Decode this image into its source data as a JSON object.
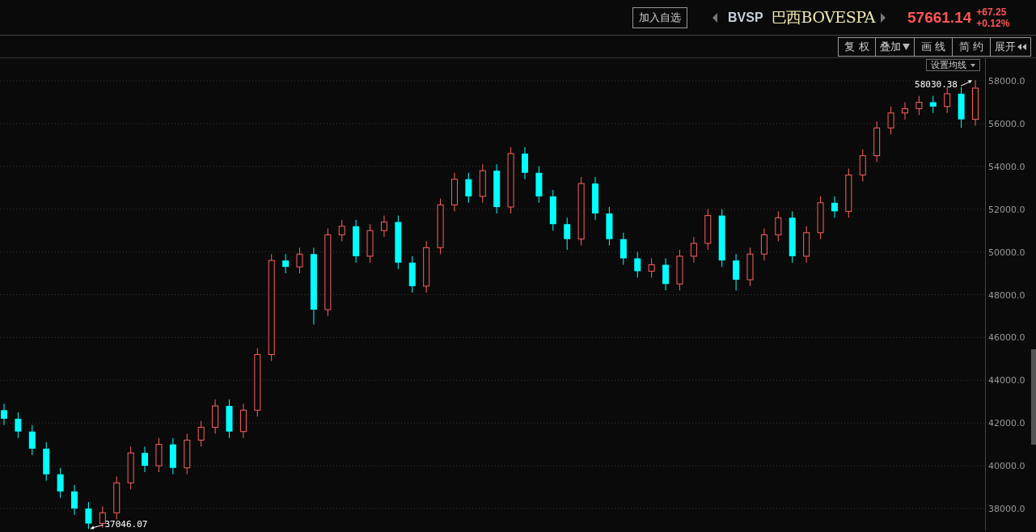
{
  "header": {
    "watch_button": "加入自选",
    "symbol": "BVSP",
    "name": "巴西BOVESPA",
    "price": "57661.14",
    "change": "+67.25",
    "change_percent": "+0.12%"
  },
  "toolbar": [
    {
      "label": "复 权",
      "kind": "plain"
    },
    {
      "label": "叠加",
      "kind": "dropdown"
    },
    {
      "label": "画 线",
      "kind": "plain"
    },
    {
      "label": "简 约",
      "kind": "plain"
    },
    {
      "label": "展开",
      "kind": "expand"
    }
  ],
  "ma_dropdown": "设置均线",
  "chart_data": {
    "type": "candlestick",
    "ylim": [
      36940,
      59060
    ],
    "yticks": [
      {
        "value": 38000,
        "label": "38000.0"
      },
      {
        "value": 40000,
        "label": "40000.0"
      },
      {
        "value": 42000,
        "label": "42000.0"
      },
      {
        "value": 44000,
        "label": "44000.0"
      },
      {
        "value": 46000,
        "label": "46000.0"
      },
      {
        "value": 48000,
        "label": "48000.0"
      },
      {
        "value": 50000,
        "label": "50000.0"
      },
      {
        "value": 52000,
        "label": "52000.0"
      },
      {
        "value": 54000,
        "label": "54000.0"
      },
      {
        "value": 56000,
        "label": "56000.0"
      },
      {
        "value": 58000,
        "label": "58000.0"
      }
    ],
    "grid": true,
    "ohlc": [
      [
        42600,
        42900,
        41900,
        42200
      ],
      [
        42200,
        42500,
        41300,
        41600
      ],
      [
        41600,
        41900,
        40500,
        40800
      ],
      [
        40800,
        41100,
        39300,
        39600
      ],
      [
        39600,
        39900,
        38500,
        38800
      ],
      [
        38800,
        39100,
        37700,
        38000
      ],
      [
        38000,
        38300,
        37046,
        37300
      ],
      [
        37300,
        38100,
        37100,
        37800
      ],
      [
        37800,
        39500,
        37500,
        39200
      ],
      [
        39200,
        40900,
        38900,
        40600
      ],
      [
        40600,
        40900,
        39700,
        40000
      ],
      [
        40000,
        41300,
        39700,
        41000
      ],
      [
        41000,
        41300,
        39600,
        39900
      ],
      [
        39900,
        41500,
        39600,
        41200
      ],
      [
        41200,
        42100,
        40900,
        41800
      ],
      [
        41800,
        43100,
        41500,
        42800
      ],
      [
        42800,
        43100,
        41300,
        41600
      ],
      [
        41600,
        42900,
        41300,
        42600
      ],
      [
        42600,
        45500,
        42300,
        45200
      ],
      [
        45200,
        49900,
        44900,
        49600
      ],
      [
        49600,
        49900,
        49000,
        49300
      ],
      [
        49300,
        50200,
        49000,
        49900
      ],
      [
        49900,
        50200,
        46600,
        47300
      ],
      [
        47300,
        51100,
        47000,
        50800
      ],
      [
        50800,
        51500,
        50500,
        51200
      ],
      [
        51200,
        51500,
        49500,
        49800
      ],
      [
        49800,
        51300,
        49500,
        51000
      ],
      [
        51000,
        51700,
        50700,
        51400
      ],
      [
        51400,
        51700,
        49200,
        49500
      ],
      [
        49500,
        49800,
        48100,
        48400
      ],
      [
        48400,
        50500,
        48100,
        50200
      ],
      [
        50200,
        52500,
        49900,
        52200
      ],
      [
        52200,
        53700,
        51900,
        53400
      ],
      [
        53400,
        53700,
        52300,
        52600
      ],
      [
        52600,
        54100,
        52300,
        53800
      ],
      [
        53800,
        54100,
        51800,
        52100
      ],
      [
        52100,
        54900,
        51800,
        54600
      ],
      [
        54600,
        54900,
        53400,
        53700
      ],
      [
        53700,
        54000,
        52300,
        52600
      ],
      [
        52600,
        52900,
        51000,
        51300
      ],
      [
        51300,
        51600,
        50100,
        50600
      ],
      [
        50600,
        53500,
        50300,
        53200
      ],
      [
        53200,
        53500,
        51500,
        51800
      ],
      [
        51800,
        52100,
        50300,
        50600
      ],
      [
        50600,
        50900,
        49400,
        49700
      ],
      [
        49700,
        50000,
        48800,
        49100
      ],
      [
        49100,
        49700,
        48800,
        49400
      ],
      [
        49400,
        49700,
        48200,
        48500
      ],
      [
        48500,
        50100,
        48200,
        49800
      ],
      [
        49800,
        50700,
        49500,
        50400
      ],
      [
        50400,
        52000,
        50100,
        51700
      ],
      [
        51700,
        52000,
        49300,
        49600
      ],
      [
        49600,
        49900,
        48200,
        48700
      ],
      [
        48700,
        50200,
        48400,
        49900
      ],
      [
        49900,
        51100,
        49600,
        50800
      ],
      [
        50800,
        51900,
        50500,
        51600
      ],
      [
        51600,
        51900,
        49500,
        49800
      ],
      [
        49800,
        51200,
        49500,
        50900
      ],
      [
        50900,
        52600,
        50600,
        52300
      ],
      [
        52300,
        52600,
        51600,
        51900
      ],
      [
        51900,
        53900,
        51600,
        53600
      ],
      [
        53600,
        54800,
        53300,
        54500
      ],
      [
        54500,
        56100,
        54200,
        55800
      ],
      [
        55800,
        56800,
        55500,
        56500
      ],
      [
        56500,
        57000,
        56200,
        56700
      ],
      [
        56700,
        57300,
        56400,
        57000
      ],
      [
        57000,
        57300,
        56500,
        56800
      ],
      [
        56800,
        57700,
        56500,
        57400
      ],
      [
        57400,
        57700,
        55800,
        56200
      ],
      [
        56200,
        58030,
        55900,
        57660
      ]
    ],
    "annotations": [
      "58030.38",
      "37046.07"
    ]
  }
}
